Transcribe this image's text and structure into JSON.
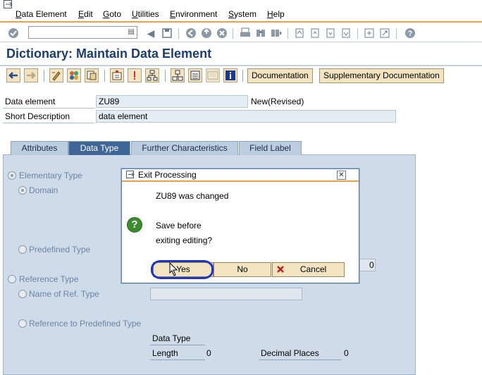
{
  "menu": [
    "Data Element",
    "Edit",
    "Goto",
    "Utilities",
    "Environment",
    "System",
    "Help"
  ],
  "command_field": {
    "value": ""
  },
  "title": "Dictionary: Maintain Data Element",
  "app_toolbar": {
    "documentation": "Documentation",
    "supplementary_documentation": "Supplementary Documentation"
  },
  "header": {
    "data_element_label": "Data element",
    "data_element_value": "ZU89",
    "status": "New(Revised)",
    "short_description_label": "Short Description",
    "short_description_value": "data element"
  },
  "tabs": [
    {
      "label": "Attributes",
      "active": false
    },
    {
      "label": "Data Type",
      "active": true
    },
    {
      "label": "Further Characteristics",
      "active": false
    },
    {
      "label": "Field Label",
      "active": false
    }
  ],
  "panel": {
    "elementary_type": "Elementary Type",
    "domain": "Domain",
    "predefined_type": "Predefined Type",
    "reference_type": "Reference Type",
    "name_of_ref_type": "Name of Ref. Type",
    "reference_to_predefined_type": "Reference to Predefined Type",
    "data_type": "Data Type",
    "length": "Length",
    "length_value": "0",
    "decimal_places": "Decimal Places",
    "decimal_places_value": "0",
    "hidden_field_value": "0"
  },
  "dialog": {
    "title": "Exit Processing",
    "message_1": "ZU89 was changed",
    "message_2": "Save before",
    "message_3": "exiting editing?",
    "yes": "Yes",
    "no": "No",
    "cancel": "Cancel"
  },
  "colors": {
    "title": "#1c3e6e",
    "active_tab": "#3f6697",
    "panel_bg": "#cfdbe8",
    "button_bg": "#f2e4c0",
    "accent_rule": "#e3a34a",
    "highlight": "#1c35c8"
  }
}
